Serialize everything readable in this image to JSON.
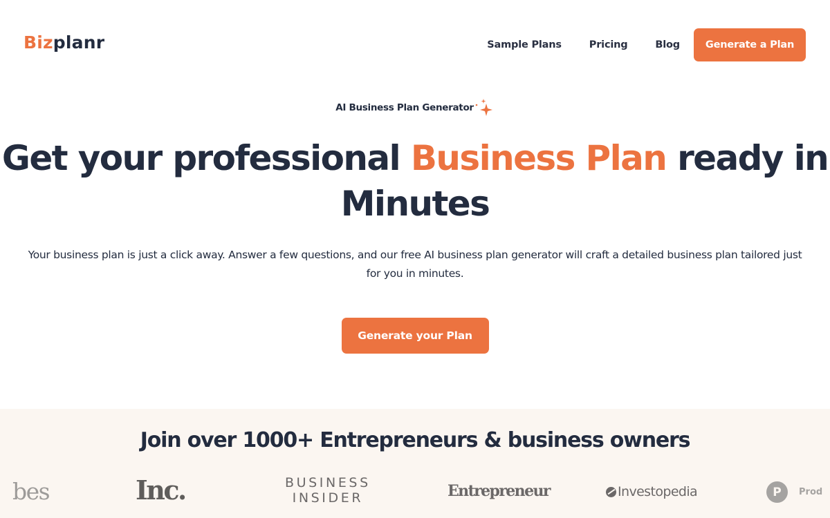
{
  "header": {
    "logo": {
      "part1": "Biz",
      "part2": "planr"
    },
    "nav": [
      {
        "label": "Sample Plans"
      },
      {
        "label": "Pricing"
      },
      {
        "label": "Blog"
      }
    ],
    "cta_label": "Generate a Plan"
  },
  "hero": {
    "eyebrow": "AI Business Plan Generator",
    "eyebrow_icon": "sparkle-icon",
    "headline": {
      "before": "Get your professional ",
      "accent": "Business Plan",
      "after": " ready in Minutes"
    },
    "subtitle": "Your business plan is just a click away. Answer a few questions, and our free AI business plan generator will craft a detailed business plan tailored just for you in minutes.",
    "cta_label": "Generate your Plan"
  },
  "social_proof": {
    "title": "Join over 1000+ Entrepreneurs & business owners",
    "logos": [
      {
        "name": "Forbes",
        "text": "bes"
      },
      {
        "name": "Inc.",
        "text": "Inc."
      },
      {
        "name": "Business Insider",
        "line1": "BUSINESS",
        "line2": "INSIDER"
      },
      {
        "name": "Entrepreneur",
        "text": "Entrepreneur"
      },
      {
        "name": "Investopedia",
        "text": "Investopedia"
      },
      {
        "name": "Product Hunt",
        "mark": "P",
        "text": "Prod"
      }
    ]
  },
  "colors": {
    "accent": "#ec7340",
    "text_dark": "#232c3f",
    "proof_background": "#fbf6f1",
    "logo_gray": "#6b6868"
  }
}
